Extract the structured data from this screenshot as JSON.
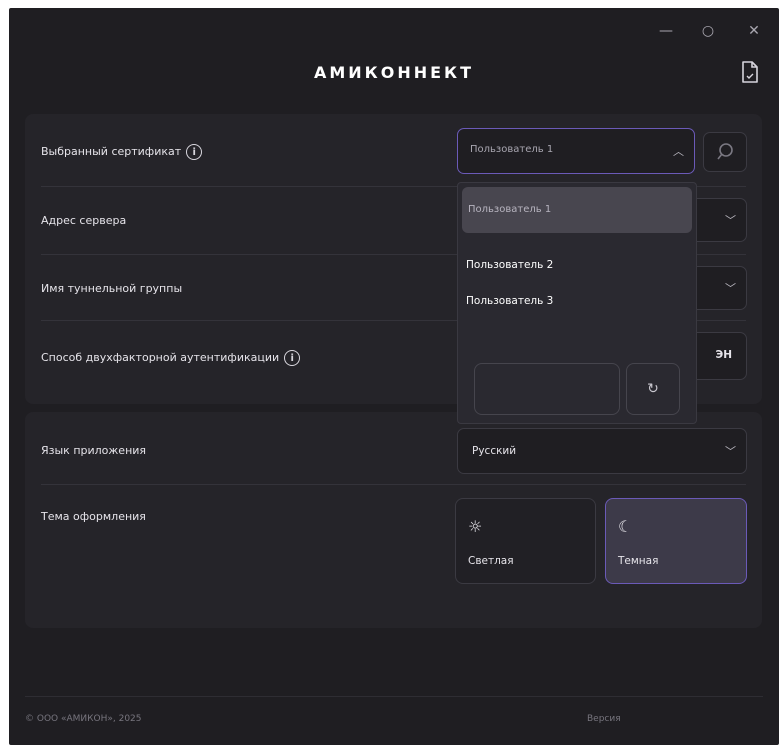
{
  "window": {
    "title": "АМИКОННЕКТ",
    "controls": {
      "minimize": "—",
      "maximize": "○",
      "close": "✕"
    }
  },
  "security": {
    "certificate": {
      "label": "Выбранный сертификат",
      "selected": "Пользователь 1",
      "options": [
        "Пользователь 1",
        "Пользователь 2",
        "Пользователь 3"
      ]
    },
    "server_address": {
      "label": "Адрес сервера"
    },
    "tunnel_group": {
      "label": "Имя туннельной группы"
    },
    "two_factor": {
      "label": "Способ двухфакторной аутентификации",
      "value_fragment": "ЭН"
    }
  },
  "appearance": {
    "language": {
      "label": "Язык приложения",
      "value": "Русский"
    },
    "theme": {
      "label": "Тема оформления",
      "options": [
        {
          "label": "Светлая",
          "icon": "sun-icon",
          "active": false
        },
        {
          "label": "Темная",
          "icon": "moon-icon",
          "active": true
        }
      ]
    }
  },
  "footer": {
    "copyright": "© ООО «АМИКОН», 2025",
    "version_label": "Версия"
  },
  "colors": {
    "background": "#1f1e22",
    "card": "#252429",
    "accent": "#6b5ab8"
  }
}
